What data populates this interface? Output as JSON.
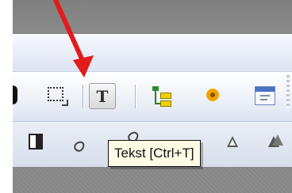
{
  "toolbar": {
    "text_tool": {
      "glyph": "T",
      "tooltip": "Tekst [Ctrl+T]"
    },
    "icons": [
      "select-area-icon",
      "text-tool-icon",
      "tree-icon",
      "gear-icon",
      "window-icon",
      "grip-icon"
    ]
  },
  "secondary_toolbar": {
    "icons": [
      "bookmark-icon",
      "drop-icon",
      "triangle-icon",
      "double-triangle-icon"
    ]
  },
  "annotation": {
    "arrow_color": "#e31b1b"
  },
  "colors": {
    "tooltip_bg": "#fffbe4",
    "toolbar_bg": "#e6ebf5"
  }
}
